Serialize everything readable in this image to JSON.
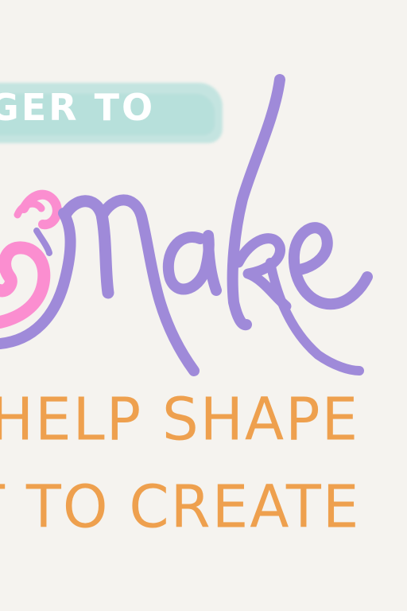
{
  "top_banner": {
    "text": "GER TO"
  },
  "headline": {
    "word": "Make"
  },
  "lines": [
    {
      "text": "HELP SHAPE"
    },
    {
      "text": "T TO CREATE"
    }
  ],
  "colors": {
    "background": "#f5f3ef",
    "wash": "#bfe3df",
    "purple": "#9f8ad9",
    "pink": "#fb8ed0",
    "orange": "#eea04e",
    "white": "#ffffff"
  },
  "icons": [
    "pink-swirl-icon"
  ]
}
